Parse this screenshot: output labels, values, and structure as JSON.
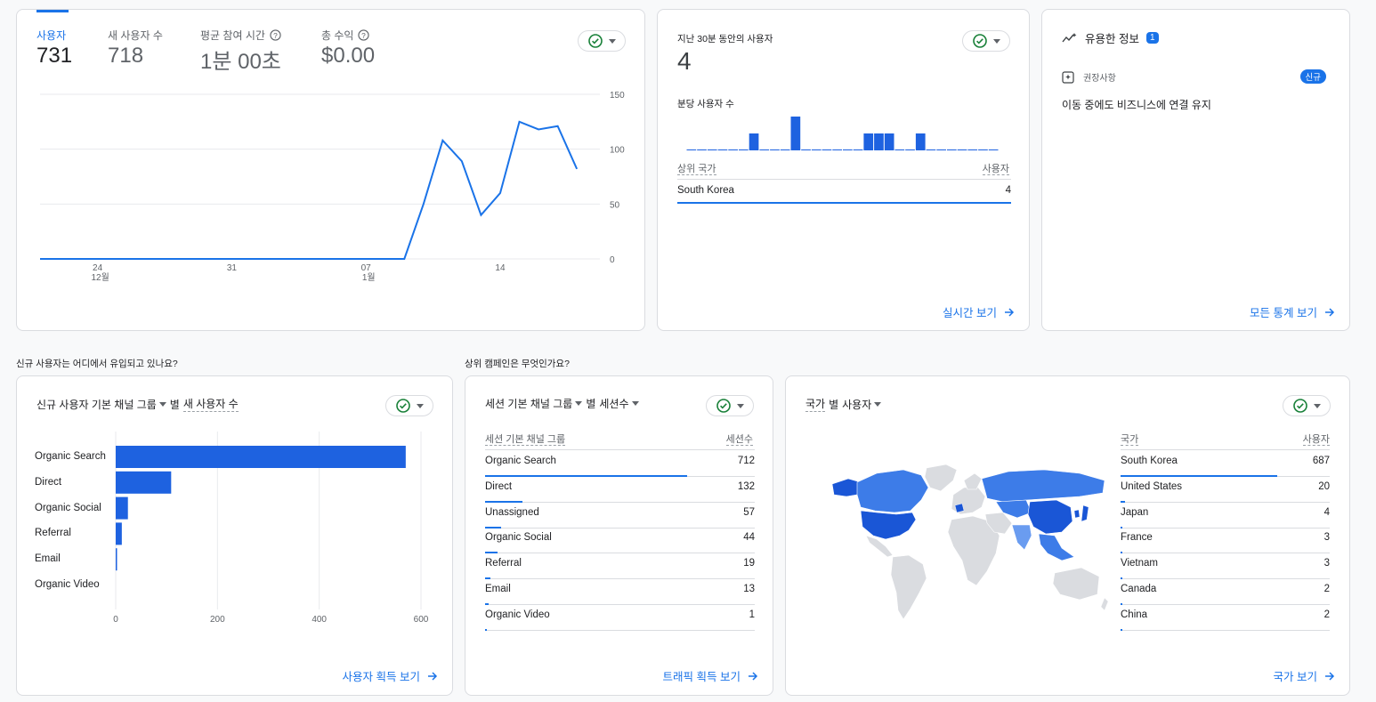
{
  "overview": {
    "metrics": [
      {
        "label": "사용자",
        "value": "731",
        "active": true,
        "help": false
      },
      {
        "label": "새 사용자 수",
        "value": "718",
        "active": false,
        "help": false
      },
      {
        "label": "평균 참여 시간",
        "value": "1분 00초",
        "active": false,
        "help": true
      },
      {
        "label": "총 수익",
        "value": "$0.00",
        "active": false,
        "help": true
      }
    ],
    "y_ticks": [
      "150",
      "100",
      "50",
      "0"
    ],
    "x_ticks": [
      {
        "day": "24",
        "month": "12월"
      },
      {
        "day": "31",
        "month": ""
      },
      {
        "day": "07",
        "month": "1월"
      },
      {
        "day": "14",
        "month": ""
      }
    ]
  },
  "chart_data": {
    "type": "line",
    "title": "",
    "xlabel": "",
    "ylabel": "",
    "ylim": [
      0,
      150
    ],
    "grid": true,
    "series": [
      {
        "values": [
          0,
          0,
          0,
          0,
          0,
          0,
          0,
          0,
          0,
          0,
          0,
          0,
          0,
          0,
          0,
          0,
          0,
          0,
          0,
          0,
          50,
          108,
          89,
          40,
          60,
          125,
          118,
          121,
          82
        ]
      }
    ]
  },
  "realtime": {
    "title": "지난 30분 동안의 사용자",
    "value": "4",
    "per_minute_label": "분당 사용자 수",
    "per_minute_values": [
      0,
      0,
      0,
      0,
      0,
      0,
      1,
      0,
      0,
      0,
      2,
      0,
      0,
      0,
      0,
      0,
      0,
      1,
      1,
      1,
      0,
      0,
      1,
      0,
      0,
      0,
      0,
      0,
      0,
      0
    ],
    "table_header_country": "상위 국가",
    "table_header_users": "사용자",
    "rows": [
      {
        "name": "South Korea",
        "value": "4"
      }
    ],
    "link": "실시간 보기"
  },
  "insights": {
    "title": "유용한 정보",
    "badge": "1",
    "item_type": "권장사항",
    "new_badge": "신규",
    "item_text": "이동 중에도 비즈니스에 연결 유지",
    "link": "모든 통계 보기"
  },
  "sections": {
    "acquisition_question": "신규 사용자는 어디에서 유입되고 있나요?",
    "campaign_question": "상위 캠페인은 무엇인가요?"
  },
  "acquisition": {
    "title_dim": "신규 사용자 기본 채널 그룹",
    "title_by": "별",
    "title_metric": "새 사용자 수",
    "link": "사용자 획득 보기",
    "x_ticks": [
      "0",
      "200",
      "400",
      "600"
    ],
    "max": 600,
    "bars": [
      {
        "label": "Organic Search",
        "value": 570
      },
      {
        "label": "Direct",
        "value": 109
      },
      {
        "label": "Organic Social",
        "value": 24
      },
      {
        "label": "Referral",
        "value": 12
      },
      {
        "label": "Email",
        "value": 2
      },
      {
        "label": "Organic Video",
        "value": 0
      }
    ]
  },
  "traffic": {
    "title_dim": "세션 기본 채널 그룹",
    "title_by": "별",
    "title_metric": "세션수",
    "header_dim": "세션 기본 채널 그룹",
    "header_metric": "세션수",
    "max": 712,
    "rows": [
      {
        "name": "Organic Search",
        "value": 712
      },
      {
        "name": "Direct",
        "value": 132
      },
      {
        "name": "Unassigned",
        "value": 57
      },
      {
        "name": "Organic Social",
        "value": 44
      },
      {
        "name": "Referral",
        "value": 19
      },
      {
        "name": "Email",
        "value": 13
      },
      {
        "name": "Organic Video",
        "value": 1
      }
    ],
    "link": "트래픽 획득 보기"
  },
  "countries": {
    "title_dim": "국가",
    "title_by": "별",
    "title_metric": "사용자",
    "header_dim": "국가",
    "header_metric": "사용자",
    "max": 687,
    "rows": [
      {
        "name": "South Korea",
        "value": 687
      },
      {
        "name": "United States",
        "value": 20
      },
      {
        "name": "Japan",
        "value": 4
      },
      {
        "name": "France",
        "value": 3
      },
      {
        "name": "Vietnam",
        "value": 3
      },
      {
        "name": "Canada",
        "value": 2
      },
      {
        "name": "China",
        "value": 2
      }
    ],
    "link": "국가 보기"
  },
  "colors": {
    "accent": "#1a73e8",
    "bar": "#1e62e0",
    "check": "#188038",
    "map_land": "#dadce0",
    "map_high": "#1a56d6",
    "map_mid": "#3d7ce8",
    "map_low": "#6a9cf0"
  }
}
